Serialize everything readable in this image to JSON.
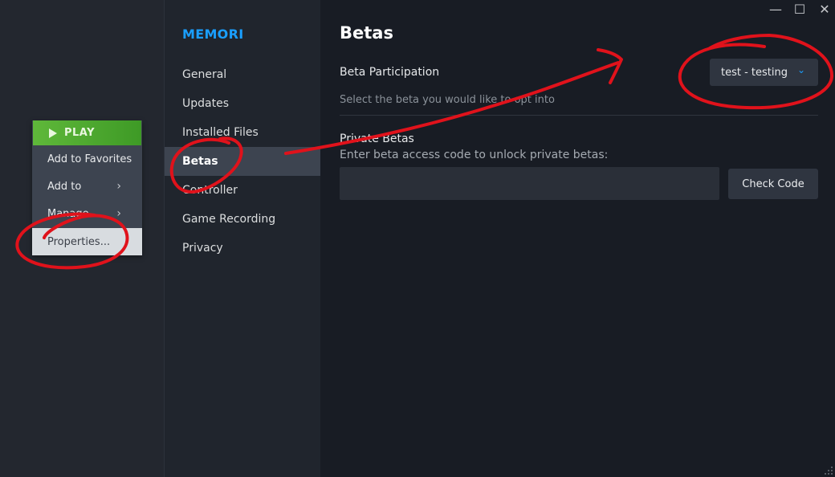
{
  "window": {
    "minimize_glyph": "—",
    "maximize_glyph": "☐",
    "close_glyph": "✕"
  },
  "context_menu": {
    "play_label": "PLAY",
    "items": [
      {
        "label": "Add to Favorites",
        "has_submenu": false
      },
      {
        "label": "Add to",
        "has_submenu": true
      },
      {
        "label": "Manage",
        "has_submenu": true
      },
      {
        "label": "Properties...",
        "has_submenu": false,
        "selected": true
      }
    ],
    "submenu_glyph": "›"
  },
  "settings_nav": {
    "app_title": "MEMORI",
    "items": [
      {
        "label": "General"
      },
      {
        "label": "Updates"
      },
      {
        "label": "Installed Files"
      },
      {
        "label": "Betas",
        "active": true
      },
      {
        "label": "Controller"
      },
      {
        "label": "Game Recording"
      },
      {
        "label": "Privacy"
      }
    ]
  },
  "content": {
    "title": "Betas",
    "beta_participation": {
      "label": "Beta Participation",
      "description": "Select the beta you would like to opt into",
      "selected_value": "test - testing",
      "chevron_glyph": "⌄"
    },
    "private_betas": {
      "label": "Private Betas",
      "description": "Enter beta access code to unlock private betas:",
      "input_value": "",
      "input_placeholder": "",
      "check_button_label": "Check Code"
    }
  },
  "colors": {
    "accent": "#1a9fff",
    "play_green": "#5fb83a",
    "annotation_red": "#e0121b",
    "background": "#181c24",
    "nav_active": "#3d4450"
  }
}
